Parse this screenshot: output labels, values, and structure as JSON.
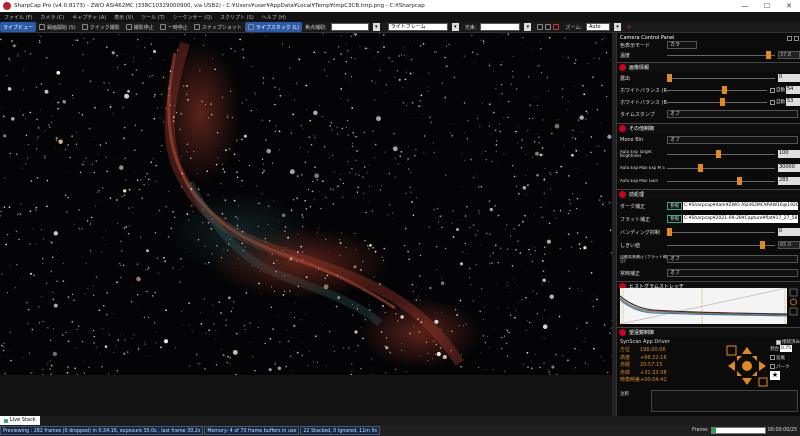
{
  "window": {
    "title": "SharpCap Pro (v4.0.8173) - ZWO ASI462MC (338C10329000900, via USB2) - C:¥Users¥user¥AppData¥Local¥Temp¥tmpC3CB.tmp.png - C:¥Sharpcap",
    "minimize": "—",
    "maximize": "☐",
    "close": "✕"
  },
  "menu": [
    "ファイル (F)",
    "カメラ (C)",
    "キャプチャ (A)",
    "表示 (V)",
    "ツール (T)",
    "シーケンサー (Q)",
    "スクリプト (S)",
    "ヘルプ (H)"
  ],
  "toolbar": {
    "live_view": "ライブビュー",
    "start_capture": "録画開始 (S)",
    "quick_capture": "クイック撮影",
    "stop": "撮影停止",
    "pause": "一時停止",
    "snapshot": "スナップショット",
    "live_stack": "ライブスタック (L)",
    "focus_label": "焦点補助:",
    "focus_value": "",
    "frame_label": "ライトフレーム",
    "overlay_label": "光束:",
    "overlay_value": "",
    "zoom_label": "ズーム:",
    "zoom_value": "Auto"
  },
  "panel": {
    "title": "Camera Control Panel",
    "color_mode_label": "色表示モード",
    "color_mode_value": "カラ",
    "temp_label": "温度",
    "temp_value": "37.8",
    "sec_image": "画像情報",
    "exposure_label": "露出",
    "exposure_value": "0",
    "wb_r_label": "ホワイトバランス (R)",
    "wb_r_value": "54",
    "wb_b_label": "ホワイトバランス (B)",
    "wb_b_value": "53",
    "wb_auto": "自動",
    "timestamp_label": "タイムスタンプ",
    "timestamp_value": "オフ",
    "sec_other": "その他制御",
    "mono_bin_label": "Mono Bin",
    "mono_bin_value": "オフ",
    "auto_target_label": "Auto Exp Target Brightness",
    "auto_target_value": "100",
    "auto_maxexp_label": "Auto Exp Max Exp M S",
    "auto_maxexp_value": "30000",
    "auto_maxgain_label": "Auto Exp Max Gain",
    "auto_maxgain_value": "285",
    "sec_preproc": "前処理",
    "dark_label": "ダーク補正",
    "dark_btn": "参照",
    "dark_path": "C:¥Sharpcap¥dark¥ZWO ASI462MC¥RAW16@1920x1080",
    "flat_label": "フラット補正",
    "flat_btn": "参照",
    "flat_path": "C:¥Sharpcap¥2021-09-28¥Capture¥flat¥17_27_58.tiff",
    "banding_label": "バンディング抑制",
    "banding_value": "0",
    "threshold_label": "しきい値",
    "threshold_value": "65.0",
    "autoflat_label": "自動背景補正 (フラット補正)",
    "autoflat_value": "オフ",
    "deconv_label": "常時補正",
    "deconv_value": "オフ",
    "sec_histogram": "ヒストグラムストレッチ",
    "sec_mount": "望遠鏡制御",
    "mount_name": "SynScan App Driver",
    "connected_label": "接続済み",
    "ra_label": "方位",
    "ra_value": "196:00:06",
    "alt_label": "高度",
    "alt_value": "+66:22:16",
    "rahr_label": "赤経",
    "rahr_value": "20:57:15",
    "dec_label": "赤緯",
    "dec_value": "+31:33:38",
    "ha_label": "時角時差",
    "ha_value": "+00:04:41",
    "rate_label": "割合",
    "rate_value": "0.75",
    "tracking_label": "追尾",
    "park_label": "パーク",
    "notes_label": "注釈"
  },
  "tabs": [
    {
      "label": "Live Stack"
    }
  ],
  "status": {
    "previewing": "Previewing : 282 frames (0 dropped) in 0:34:16, exposure 30.0s , last frame 30.2s",
    "memory": "Memory: 4 of 73 frame buffers in use",
    "stacked": "22 Stacked, 0 Ignored, 11m 0s",
    "frame_label": "Frame:",
    "frame_time": "00:00:00/25"
  },
  "colors": {
    "accent": "#e08a1e",
    "live_active": "#2a5aa8",
    "status_blue": "#0b2a55",
    "section_bullet": "#cc0022"
  }
}
